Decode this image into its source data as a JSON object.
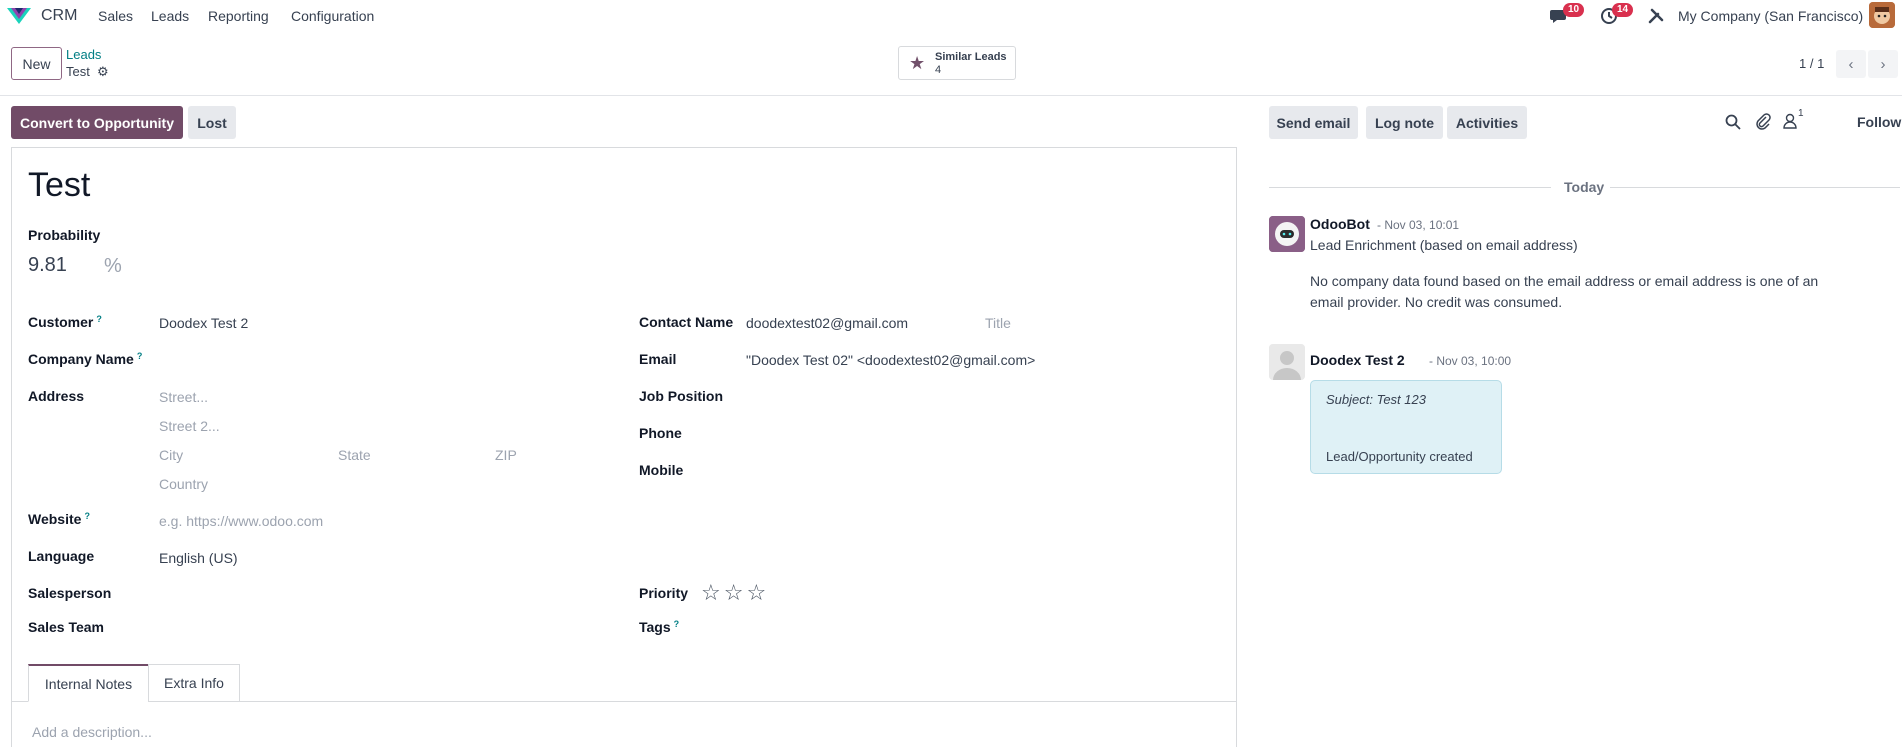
{
  "nav": {
    "app": "CRM",
    "menu": [
      "Sales",
      "Leads",
      "Reporting",
      "Configuration"
    ],
    "messages_badge": "10",
    "activities_badge": "14",
    "company": "My Company (San Francisco)"
  },
  "control": {
    "new_label": "New",
    "breadcrumb_parent": "Leads",
    "breadcrumb_current": "Test",
    "similar_label": "Similar Leads",
    "similar_count": "4",
    "pager": "1 / 1"
  },
  "status": {
    "convert_label": "Convert to Opportunity",
    "lost_label": "Lost"
  },
  "form": {
    "title": "Test",
    "probability_label": "Probability",
    "probability_value": "9.81",
    "probability_unit": "%",
    "left": {
      "customer_label": "Customer",
      "customer_value": "Doodex Test 2",
      "company_label": "Company Name",
      "address_label": "Address",
      "street_ph": "Street...",
      "street2_ph": "Street 2...",
      "city_ph": "City",
      "state_ph": "State",
      "zip_ph": "ZIP",
      "country_ph": "Country",
      "website_label": "Website",
      "website_ph": "e.g. https://www.odoo.com",
      "language_label": "Language",
      "language_value": "English (US)",
      "salesperson_label": "Salesperson",
      "team_label": "Sales Team"
    },
    "right": {
      "contact_label": "Contact Name",
      "contact_value": "doodextest02@gmail.com",
      "title_ph": "Title",
      "email_label": "Email",
      "email_value": "\"Doodex Test 02\" <doodextest02@gmail.com>",
      "job_label": "Job Position",
      "phone_label": "Phone",
      "mobile_label": "Mobile",
      "priority_label": "Priority",
      "priority_stars": "☆☆☆",
      "priority_value": 0,
      "tags_label": "Tags"
    },
    "tabs": [
      "Internal Notes",
      "Extra Info"
    ],
    "description_ph": "Add a description...",
    "help_mark": "?"
  },
  "chatter": {
    "send_email": "Send email",
    "log_note": "Log note",
    "activities": "Activities",
    "followers_count": "1",
    "follow": "Follow",
    "today": "Today",
    "messages": [
      {
        "author": "OdooBot",
        "date": "- Nov 03, 10:01",
        "line1": "Lead Enrichment (based on email address)",
        "line2": "No company data found based on the email address or email address is one of an",
        "line3": "email provider. No credit was consumed."
      },
      {
        "author": "Doodex Test 2",
        "date": "- Nov 03, 10:00",
        "subject": "Subject: Test 123",
        "body": "Lead/Opportunity created"
      }
    ]
  },
  "colors": {
    "brand": "#714b67",
    "link": "#017e84",
    "badge": "#d9304e"
  }
}
